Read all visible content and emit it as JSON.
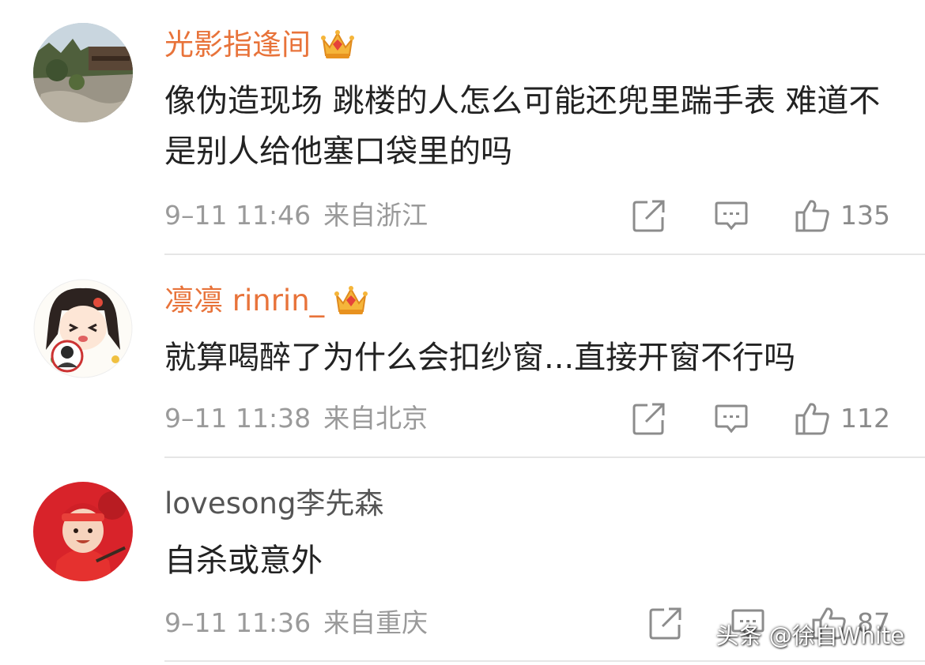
{
  "comments": [
    {
      "username": "光影指逢间",
      "vip": true,
      "text": "像伪造现场 跳楼的人怎么可能还兜里踹手表 难道不是别人给他塞口袋里的吗",
      "time": "9–11 11:46",
      "location": "来自浙江",
      "likes": "135",
      "avatar": "landscape-photo"
    },
    {
      "username": "凛凛 rinrin_",
      "vip": true,
      "text": "就算喝醉了为什么会扣纱窗...直接开窗不行吗",
      "time": "9–11 11:38",
      "location": "来自北京",
      "likes": "112",
      "avatar": "cartoon-girl"
    },
    {
      "username": "lovesong李先森",
      "vip": false,
      "text": "自杀或意外",
      "time": "9–11 11:36",
      "location": "来自重庆",
      "likes": "87",
      "avatar": "baby-in-red"
    }
  ],
  "icons": {
    "share": "share-icon",
    "reply": "comment-icon",
    "like": "thumbs-up-icon",
    "badge": "vip-crown-icon"
  },
  "colors": {
    "vip_name": "#e8733a",
    "name": "#555555",
    "text": "#222222",
    "meta": "#9a9a9a"
  },
  "watermark": "头条 @徐自White"
}
